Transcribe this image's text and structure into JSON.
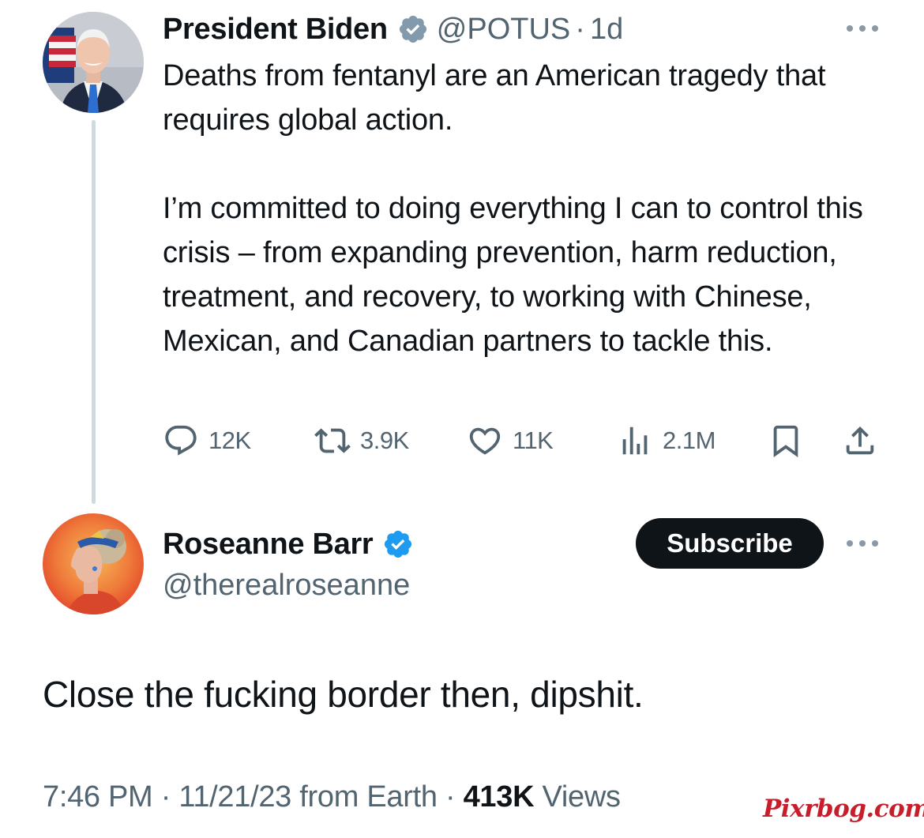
{
  "tweet": {
    "author": {
      "display_name": "President Biden",
      "handle": "@POTUS",
      "verified_badge": "gray",
      "time_ago": "1d",
      "avatar_icon": "avatar-photo"
    },
    "separator": "·",
    "paragraphs": [
      "Deaths from fentanyl are an American tragedy that requires global action.",
      "I’m committed to doing everything I can to control this crisis – from expanding prevention, harm reduction, treatment, and recovery, to working with Chinese, Mexican, and Canadian partners to tackle this."
    ],
    "metrics": {
      "replies": "12K",
      "retweets": "3.9K",
      "likes": "11K",
      "views": "2.1M"
    }
  },
  "reply": {
    "author": {
      "display_name": "Roseanne Barr",
      "handle": "@therealroseanne",
      "verified_badge": "blue",
      "avatar_icon": "avatar-photo"
    },
    "subscribe_label": "Subscribe",
    "text": "Close the fucking border then, dipshit.",
    "meta": {
      "time": "7:46 PM",
      "date": "11/21/23",
      "source": "from Earth",
      "separator": "·",
      "views_count": "413K",
      "views_label": "Views"
    }
  },
  "watermark": "Pixrbog.com",
  "colors": {
    "text_primary": "#0f1419",
    "text_secondary": "#536471",
    "verified_blue": "#1d9bf0",
    "verified_gray": "#829aab",
    "thread_line": "#cfd9de",
    "button_dark": "#0f1419",
    "watermark_red": "#c81e2c"
  }
}
